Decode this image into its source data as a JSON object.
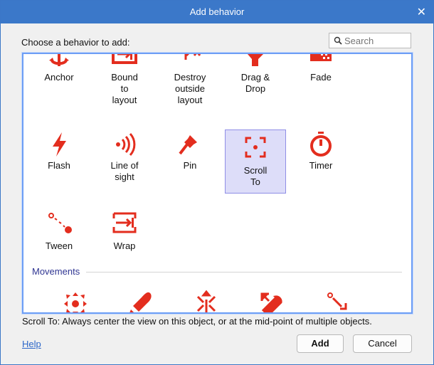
{
  "dialog": {
    "title": "Add behavior",
    "prompt": "Choose a behavior to add:",
    "search_placeholder": "Search",
    "description": "Scroll To: Always center the view on this object, or at the mid-point of multiple objects.",
    "help_label": "Help",
    "add_label": "Add",
    "cancel_label": "Cancel"
  },
  "colors": {
    "accent": "#e32d1e",
    "title_bar": "#3b78c9",
    "selected_tile": "#ddddf9",
    "section": "#2f3592"
  },
  "behaviors": [
    {
      "icon": "anchor-icon",
      "label": "Anchor"
    },
    {
      "icon": "bound-to-layout-icon",
      "label": "Bound\nto\nlayout"
    },
    {
      "icon": "destroy-outside-layout-icon",
      "label": "Destroy\noutside\nlayout"
    },
    {
      "icon": "drag-drop-icon",
      "label": "Drag &\nDrop"
    },
    {
      "icon": "fade-icon",
      "label": "Fade"
    },
    {
      "icon": "flash-icon",
      "label": "Flash"
    },
    {
      "icon": "line-of-sight-icon",
      "label": "Line of\nsight"
    },
    {
      "icon": "pin-icon",
      "label": "Pin"
    },
    {
      "icon": "scroll-to-icon",
      "label": "Scroll\nTo",
      "selected": true
    },
    {
      "icon": "timer-icon",
      "label": "Timer"
    },
    {
      "icon": "tween-icon",
      "label": "Tween"
    },
    {
      "icon": "wrap-icon",
      "label": "Wrap"
    }
  ],
  "movements": {
    "label": "Movements",
    "icons": [
      "eight-direction-icon",
      "bullet-icon",
      "car-icon",
      "custom-movement-icon",
      "move-to-icon"
    ]
  }
}
